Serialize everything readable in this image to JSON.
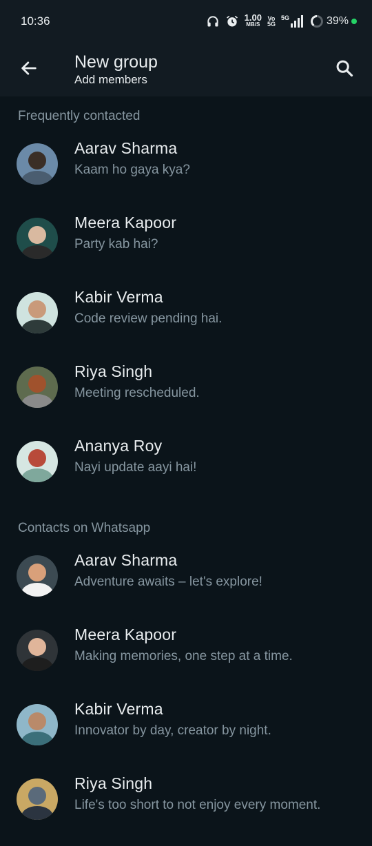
{
  "status": {
    "time": "10:36",
    "net_speed_value": "1.00",
    "net_speed_unit": "MB/S",
    "volte_top": "Vo",
    "volte_bottom": "5G",
    "network": "5G",
    "battery": "39%"
  },
  "header": {
    "title": "New group",
    "subtitle": "Add members"
  },
  "sections": [
    {
      "title": "Frequently contacted",
      "contacts": [
        {
          "name": "Aarav Sharma",
          "about": "Kaam ho gaya kya?",
          "colors": [
            "#6b8aa8",
            "#3a2e26",
            "#4a5d70"
          ]
        },
        {
          "name": "Meera Kapoor",
          "about": "Party kab hai?",
          "colors": [
            "#1f4d4a",
            "#d9b9a0",
            "#2a2a2a"
          ]
        },
        {
          "name": "Kabir Verma",
          "about": "Code review pending hai.",
          "colors": [
            "#cfe3df",
            "#c99a7a",
            "#2e3b3a"
          ]
        },
        {
          "name": "Riya Singh",
          "about": "Meeting rescheduled.",
          "colors": [
            "#5e6b4e",
            "#a0522d",
            "#8a8a8a"
          ]
        },
        {
          "name": "Ananya Roy",
          "about": "Nayi update aayi hai!",
          "colors": [
            "#d6e6e2",
            "#b84a3a",
            "#7fa89c"
          ]
        }
      ]
    },
    {
      "title": "Contacts on Whatsapp",
      "contacts": [
        {
          "name": "Aarav Sharma",
          "about": "Adventure awaits – let's explore!",
          "colors": [
            "#3c4a52",
            "#d9a07a",
            "#f2f2f2"
          ]
        },
        {
          "name": "Meera Kapoor",
          "about": "Making memories, one step at a time.",
          "colors": [
            "#2f3438",
            "#e0b59a",
            "#1e1e1e"
          ]
        },
        {
          "name": "Kabir Verma",
          "about": "Innovator by day, creator by night.",
          "colors": [
            "#8fb7c9",
            "#b98a6a",
            "#3b6f7a"
          ]
        },
        {
          "name": "Riya Singh",
          "about": "Life's too short to not enjoy every moment.",
          "colors": [
            "#c9a864",
            "#5a6a7a",
            "#2b3440"
          ]
        }
      ]
    }
  ]
}
